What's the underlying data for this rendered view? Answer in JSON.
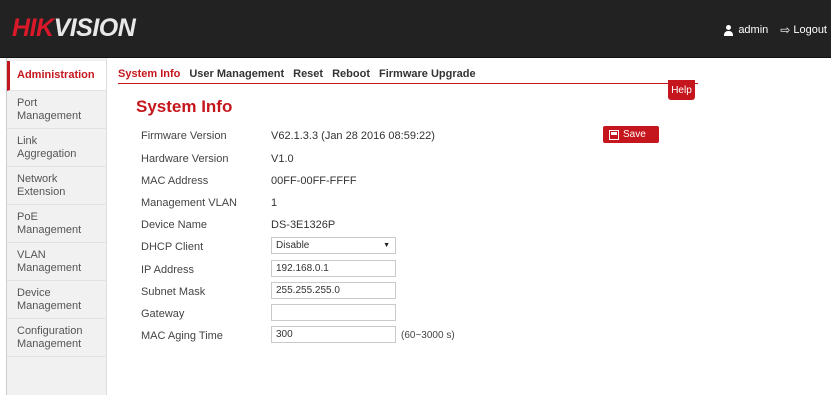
{
  "header": {
    "logo_part1": "HIK",
    "logo_part2": "VISION",
    "user_label": "admin",
    "logout_label": "Logout"
  },
  "sidebar": {
    "items": [
      {
        "label": "Administration",
        "active": true
      },
      {
        "label": "Port\nManagement"
      },
      {
        "label": "Link\nAggregation"
      },
      {
        "label": "Network\nExtension"
      },
      {
        "label": "PoE\nManagement"
      },
      {
        "label": "VLAN\nManagement"
      },
      {
        "label": "Device\nManagement"
      },
      {
        "label": "Configuration\nManagement"
      }
    ]
  },
  "tabs": [
    {
      "label": "System Info",
      "active": true
    },
    {
      "label": "User Management"
    },
    {
      "label": "Reset"
    },
    {
      "label": "Reboot"
    },
    {
      "label": "Firmware Upgrade"
    }
  ],
  "help_label": "Help",
  "page_title": "System Info",
  "save_label": "Save",
  "info": {
    "firmware_version": {
      "label": "Firmware Version",
      "value": "V62.1.3.3 (Jan 28 2016 08:59:22)"
    },
    "hardware_version": {
      "label": "Hardware Version",
      "value": "V1.0"
    },
    "mac_address": {
      "label": "MAC Address",
      "value": "00FF-00FF-FFFF"
    },
    "management_vlan": {
      "label": "Management VLAN",
      "value": "1"
    },
    "device_name": {
      "label": "Device Name",
      "value": "DS-3E1326P"
    },
    "dhcp_client": {
      "label": "DHCP Client",
      "value": "Disable"
    },
    "ip_address": {
      "label": "IP Address",
      "value": "192.168.0.1"
    },
    "subnet_mask": {
      "label": "Subnet Mask",
      "value": "255.255.255.0"
    },
    "gateway": {
      "label": "Gateway",
      "value": ""
    },
    "mac_aging_time": {
      "label": "MAC Aging Time",
      "value": "300",
      "unit": "(60~3000 s)"
    }
  },
  "colors": {
    "accent": "#c4161c",
    "header_bg": "#222222",
    "sidebar_bg": "#f1f1f1"
  }
}
